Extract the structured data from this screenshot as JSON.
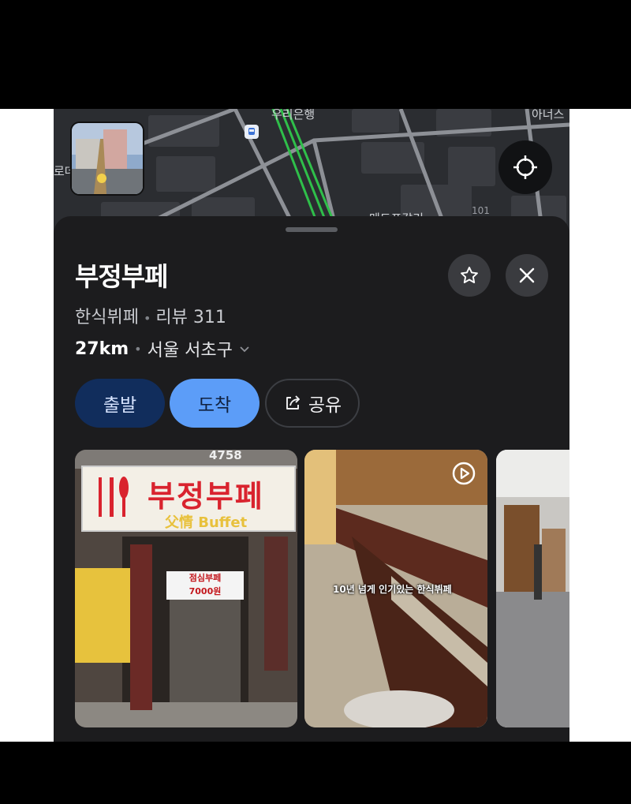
{
  "map": {
    "labels": [
      "우리은행",
      "아너스",
      "101",
      "로데",
      "메드포갈리"
    ]
  },
  "place": {
    "name": "부정부페",
    "category": "한식뷔페",
    "reviews": "리뷰 311",
    "distance": "27km",
    "region": "서울 서초구"
  },
  "actions": {
    "depart": "출발",
    "arrive": "도착",
    "share": "공유"
  },
  "photos": {
    "sign_title": "부정부페",
    "sign_sub": "父情 Buffet",
    "sign_number": "4758",
    "menu_line1": "점심부페",
    "menu_line2": "7000원",
    "video_caption": "10년 넘게 인기있는 한식뷔페"
  },
  "colors": {
    "background": "#1c1c1e",
    "depart_button": "#112d5c",
    "arrive_button": "#5c9df8",
    "route_green": "#2fbf4a"
  }
}
